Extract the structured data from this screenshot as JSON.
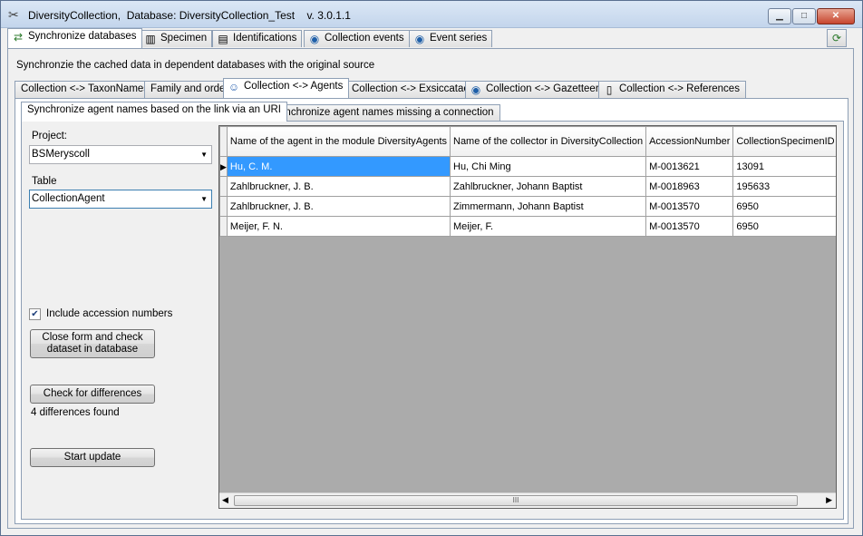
{
  "window": {
    "title": "DiversityCollection,  Database: DiversityCollection_Test    v. 3.0.1.1"
  },
  "main_tabs": [
    {
      "label": "Synchronize databases",
      "icon": "sync-icon",
      "active": true
    },
    {
      "label": "Specimen",
      "icon": "barcode-icon",
      "active": false
    },
    {
      "label": "Identifications",
      "icon": "document-icon",
      "active": false
    },
    {
      "label": "Collection events",
      "icon": "globe-icon",
      "active": false
    },
    {
      "label": "Event series",
      "icon": "globe-icon",
      "active": false
    }
  ],
  "description": "Synchronzie the cached data in dependent databases with the original source",
  "sub_tabs": [
    {
      "label": "Collection <-> TaxonNames",
      "active": false
    },
    {
      "label": "Family and order",
      "active": false
    },
    {
      "label": "Collection <-> Agents",
      "icon": "person-icon",
      "active": true
    },
    {
      "label": "Collection <-> Exsiccatae",
      "active": false
    },
    {
      "label": "Collection <-> Gazetteer",
      "icon": "globe-icon",
      "active": false
    },
    {
      "label": "Collection <-> References",
      "icon": "book-icon",
      "active": false
    }
  ],
  "inner_tabs": [
    {
      "label": "Synchronize agent names based on the link via an URI",
      "active": true
    },
    {
      "label": "Synchronize agent names missing a connection",
      "active": false
    }
  ],
  "form": {
    "project_label": "Project:",
    "project_value": "BSMeryscoll",
    "table_label": "Table",
    "table_value": "CollectionAgent",
    "include_accession_label": "Include accession numbers",
    "include_accession_checked": true,
    "close_check_button": "Close form and check dataset in database",
    "check_differences_button": "Check for differences",
    "differences_status": "4 differences found",
    "start_update_button": "Start update"
  },
  "grid": {
    "columns": [
      "Name of the agent in the module DiversityAgents",
      "Name of the collector in DiversityCollection",
      "AccessionNumber",
      "CollectionSpecimenID"
    ],
    "rows": [
      [
        "Hu, C. M.",
        "Hu, Chi Ming",
        "M-0013621",
        "13091"
      ],
      [
        "Zahlbruckner, J. B.",
        "Zahlbruckner, Johann Baptist",
        "M-0018963",
        "195633"
      ],
      [
        "Zahlbruckner, J. B.",
        "Zimmermann, Johann Baptist",
        "M-0013570",
        "6950"
      ],
      [
        "Meijer, F. N.",
        "Meijer, F.",
        "M-0013570",
        "6950"
      ]
    ],
    "current_row_marker": "▶",
    "scroll_thumb": "III"
  }
}
